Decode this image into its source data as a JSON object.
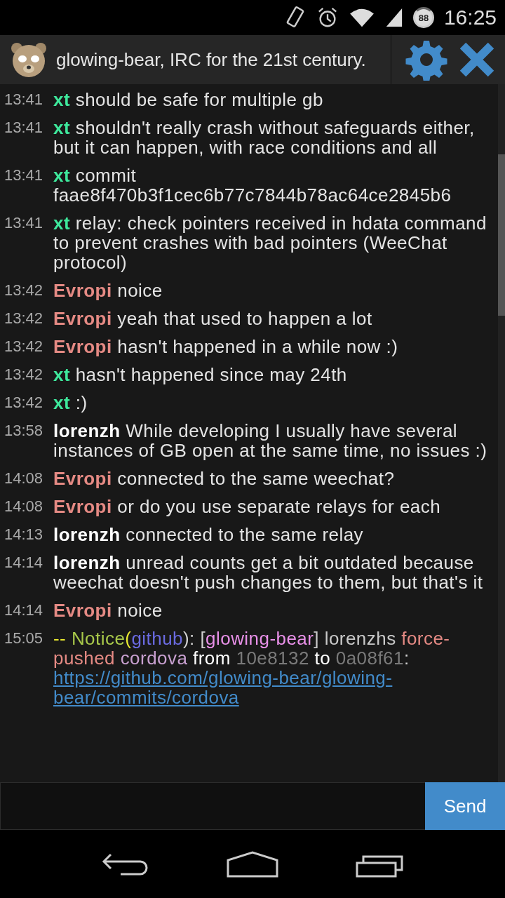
{
  "status_bar": {
    "battery": "88",
    "time": "16:25"
  },
  "header": {
    "title": "glowing-bear, IRC for the 21st century."
  },
  "messages": [
    {
      "time": "13:41",
      "nick": "xt",
      "color": "#3ee89c",
      "text": "should be safe for multiple gb"
    },
    {
      "time": "13:41",
      "nick": "xt",
      "color": "#3ee89c",
      "text": "shouldn't really crash without safeguards either, but it can happen, with race conditions and all"
    },
    {
      "time": "13:41",
      "nick": "xt",
      "color": "#3ee89c",
      "text": "commit faae8f470b3f1cec6b77c7844b78ac64ce2845b6"
    },
    {
      "time": "13:41",
      "nick": "xt",
      "color": "#3ee89c",
      "text": "relay: check pointers received in hdata command to prevent crashes with bad pointers (WeeChat protocol)"
    },
    {
      "time": "13:42",
      "nick": "Evropi",
      "color": "#e58a84",
      "text": "noice"
    },
    {
      "time": "13:42",
      "nick": "Evropi",
      "color": "#e58a84",
      "text": "yeah that used to happen a lot"
    },
    {
      "time": "13:42",
      "nick": "Evropi",
      "color": "#e58a84",
      "text": "hasn't happened in a while now :)"
    },
    {
      "time": "13:42",
      "nick": "xt",
      "color": "#3ee89c",
      "text": "hasn't happened since may 24th"
    },
    {
      "time": "13:42",
      "nick": "xt",
      "color": "#3ee89c",
      "text": ":)"
    },
    {
      "time": "13:58",
      "nick": "lorenzh",
      "color": "#ffffff",
      "text": "While developing I usually have several instances of GB open at the same time, no issues :)"
    },
    {
      "time": "14:08",
      "nick": "Evropi",
      "color": "#e58a84",
      "text": "connected to the same weechat?"
    },
    {
      "time": "14:08",
      "nick": "Evropi",
      "color": "#e58a84",
      "text": "or do you use separate relays for each"
    },
    {
      "time": "14:13",
      "nick": "lorenzh",
      "color": "#ffffff",
      "text": "connected to the same relay"
    },
    {
      "time": "14:14",
      "nick": "lorenzh",
      "color": "#ffffff",
      "text": "unread counts get a bit outdated because weechat doesn't push changes to them, but that's it"
    },
    {
      "time": "14:14",
      "nick": "Evropi",
      "color": "#e58a84",
      "text": "noice"
    }
  ],
  "notice": {
    "time": "15:05",
    "segments": [
      {
        "kind": "text",
        "text": "--",
        "color": "#e8e830"
      },
      {
        "kind": "text",
        "text": " Notice",
        "color": "#a8c84a"
      },
      {
        "kind": "text",
        "text": "(",
        "color": "#e8e830"
      },
      {
        "kind": "text",
        "text": "github",
        "color": "#6a6ae0"
      },
      {
        "kind": "text",
        "text": "): [",
        "color": "#d0d0d0"
      },
      {
        "kind": "text",
        "text": "glowing-bear",
        "color": "#e890e8"
      },
      {
        "kind": "text",
        "text": "] lorenzhs ",
        "color": "#c8c8c8"
      },
      {
        "kind": "text",
        "text": "force-pushed",
        "color": "#e58a84"
      },
      {
        "kind": "text",
        "text": " cordova",
        "color": "#c8a0d0"
      },
      {
        "kind": "text",
        "text": " from ",
        "color": "#ffffff"
      },
      {
        "kind": "text",
        "text": "10e8132",
        "color": "#7a7a7a"
      },
      {
        "kind": "text",
        "text": " to ",
        "color": "#ffffff"
      },
      {
        "kind": "text",
        "text": "0a08f61",
        "color": "#7a7a7a"
      },
      {
        "kind": "text",
        "text": ": ",
        "color": "#d0d0d0"
      },
      {
        "kind": "link",
        "text": "https://github.com/glowing-bear/glowing-bear/commits/cordova",
        "color": "#428bca"
      }
    ]
  },
  "input": {
    "button": "Send"
  }
}
